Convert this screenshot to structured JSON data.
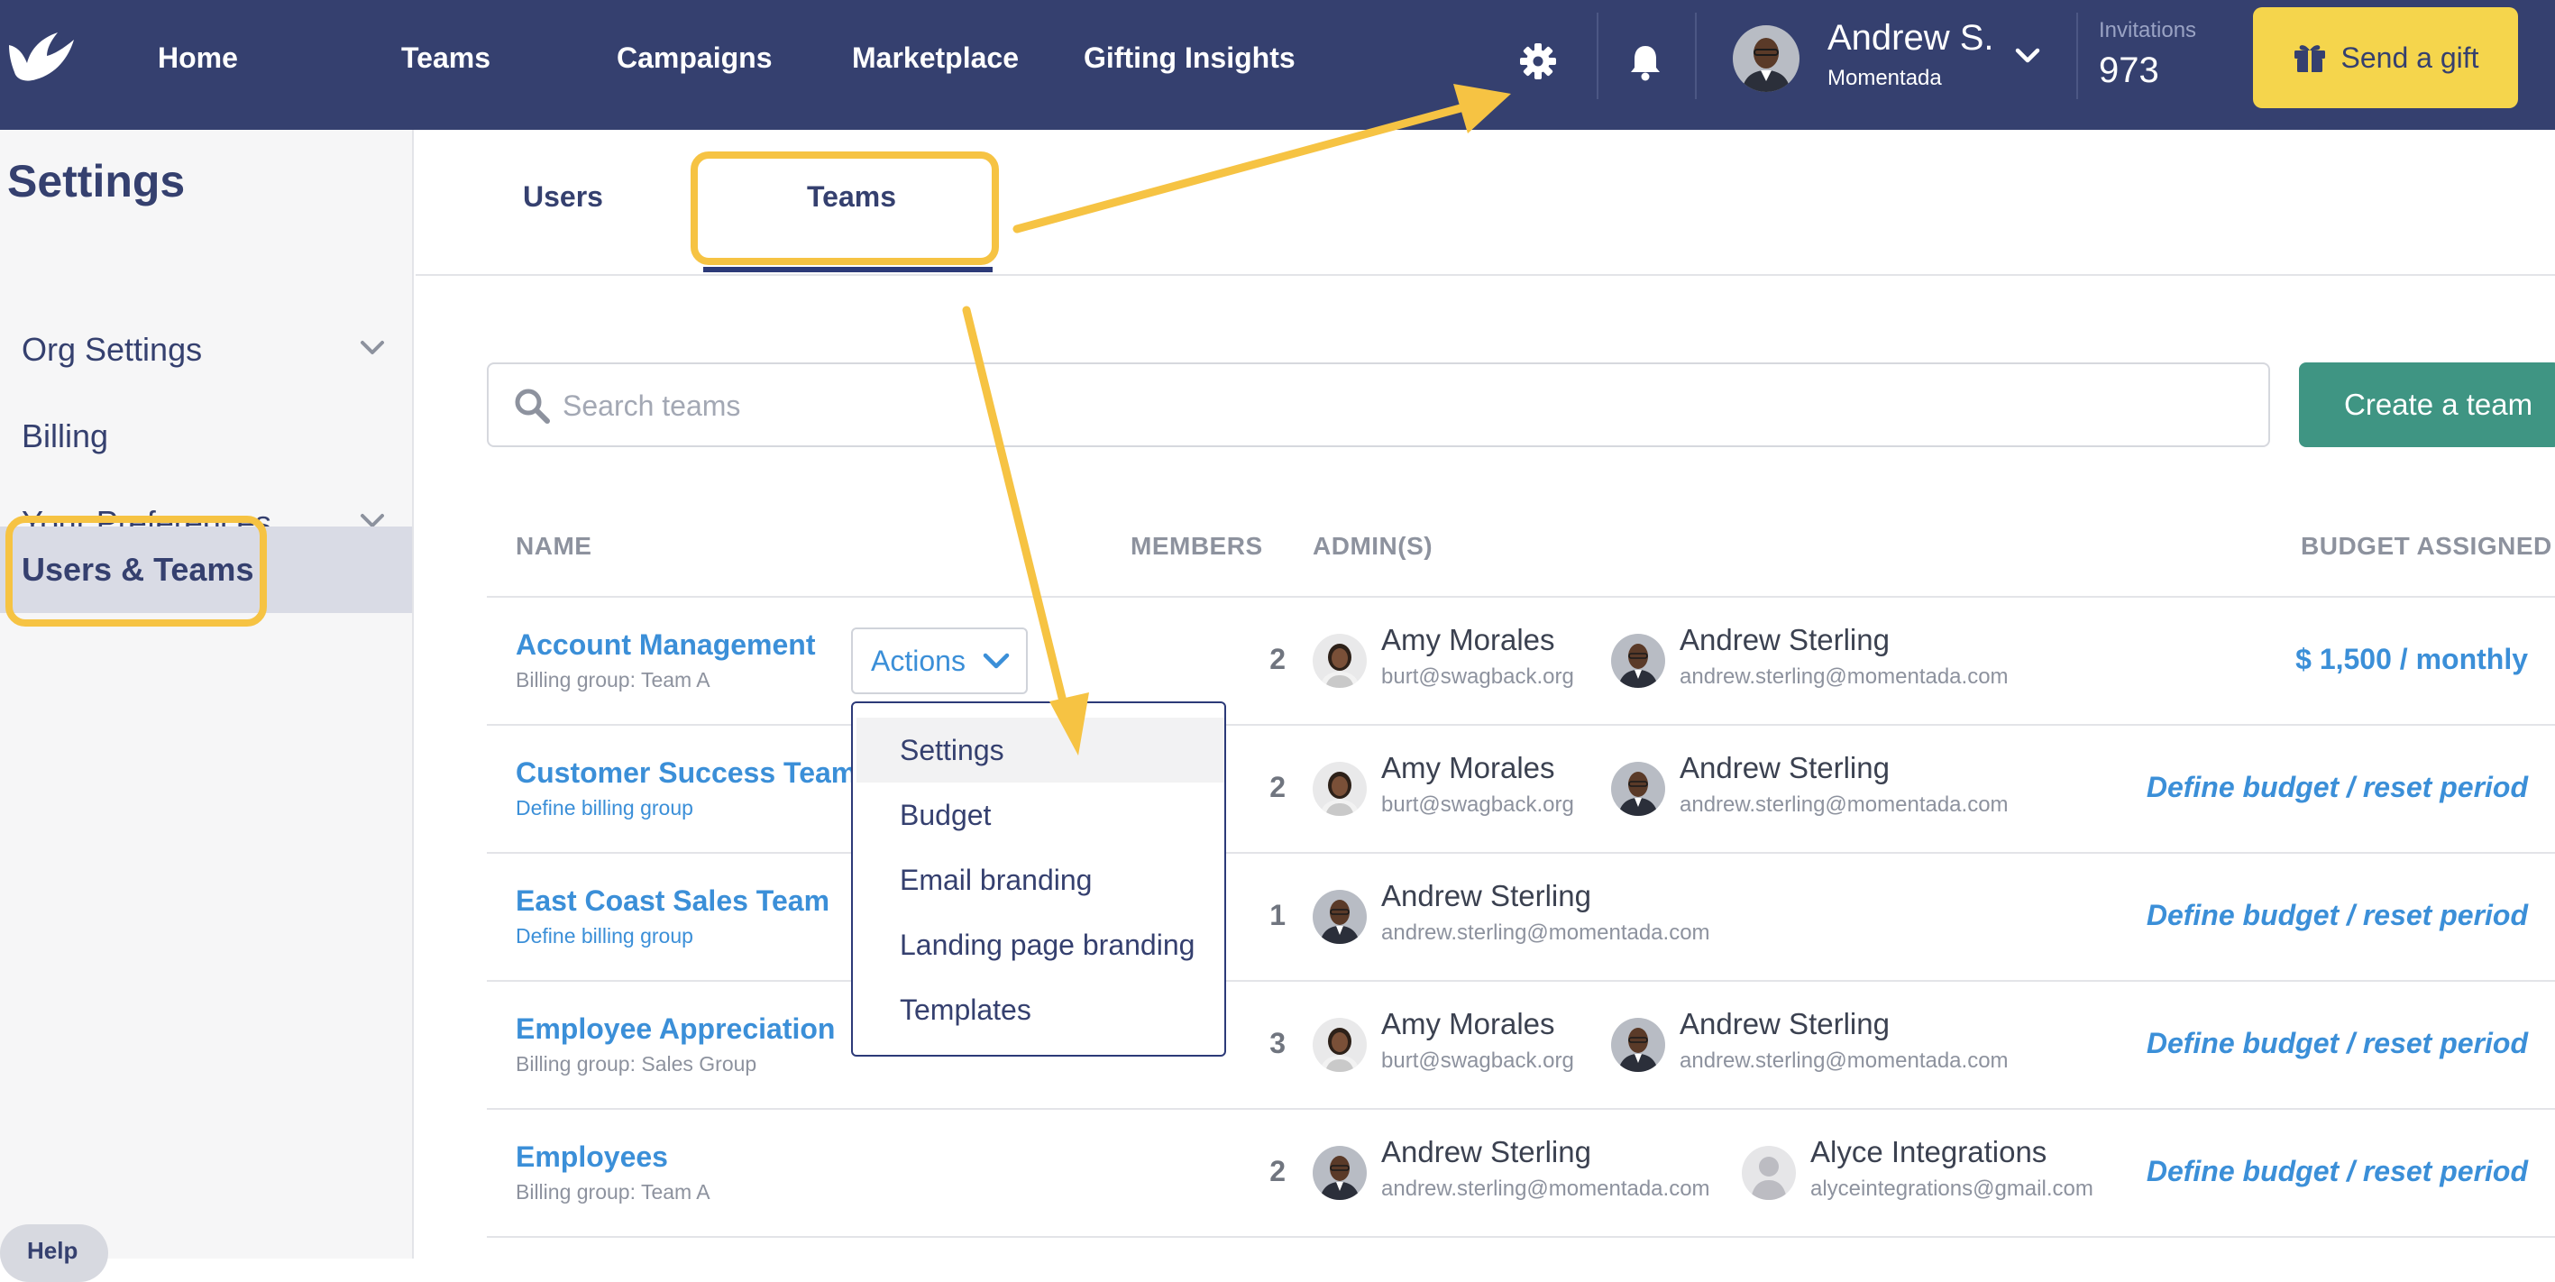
{
  "nav": {
    "links": [
      "Home",
      "Teams",
      "Campaigns",
      "Marketplace",
      "Gifting Insights"
    ],
    "user_name": "Andrew S.",
    "user_org": "Momentada",
    "invitations_label": "Invitations",
    "invitations_count": "973",
    "send_gift_label": "Send a gift"
  },
  "sidebar": {
    "title": "Settings",
    "items": [
      {
        "label": "Org Settings",
        "expandable": true
      },
      {
        "label": "Billing",
        "expandable": false
      },
      {
        "label": "Your Preferences",
        "expandable": true
      },
      {
        "label": "Users & Teams",
        "expandable": false,
        "active": true
      }
    ],
    "help_label": "Help"
  },
  "tabs": {
    "users": "Users",
    "teams": "Teams",
    "active": "Teams"
  },
  "search": {
    "placeholder": "Search teams",
    "value": ""
  },
  "create_team_label": "Create a team",
  "table": {
    "headers": {
      "name": "NAME",
      "members": "MEMBERS",
      "admins": "ADMIN(S)",
      "budget": "BUDGET ASSIGNED"
    },
    "rows": [
      {
        "name": "Account Management",
        "billing": "Billing group: Team A",
        "members": "2",
        "admins": [
          {
            "name": "Amy Morales",
            "email": "burt@swagback.org"
          },
          {
            "name": "Andrew Sterling",
            "email": "andrew.sterling@momentada.com"
          }
        ],
        "budget": "$ 1,500 / monthly"
      },
      {
        "name": "Customer Success Team - E",
        "billing": "Define billing group",
        "members": "2",
        "admins": [
          {
            "name": "Amy Morales",
            "email": "burt@swagback.org"
          },
          {
            "name": "Andrew Sterling",
            "email": "andrew.sterling@momentada.com"
          }
        ],
        "budget": "Define budget / reset period"
      },
      {
        "name": "East Coast Sales Team",
        "billing": "Define billing group",
        "members": "1",
        "admins": [
          {
            "name": "Andrew Sterling",
            "email": "andrew.sterling@momentada.com"
          }
        ],
        "budget": "Define budget / reset period"
      },
      {
        "name": "Employee Appreciation",
        "billing": "Billing group: Sales Group",
        "members": "3",
        "admins": [
          {
            "name": "Amy Morales",
            "email": "burt@swagback.org"
          },
          {
            "name": "Andrew Sterling",
            "email": "andrew.sterling@momentada.com"
          }
        ],
        "budget": "Define budget / reset period"
      },
      {
        "name": "Employees",
        "billing": "Billing group: Team A",
        "members": "2",
        "admins": [
          {
            "name": "Andrew Sterling",
            "email": "andrew.sterling@momentada.com"
          },
          {
            "name": "Alyce Integrations",
            "email": "alyceintegrations@gmail.com"
          }
        ],
        "budget": "Define budget / reset period"
      }
    ]
  },
  "actions_menu": {
    "button_label": "Actions",
    "items": [
      "Settings",
      "Budget",
      "Email branding",
      "Landing page branding",
      "Templates"
    ]
  },
  "colors": {
    "nav_bg": "#35406f",
    "accent_yellow": "#f5d54c",
    "highlight_yellow": "#f6c343",
    "link_blue": "#3b8fd8",
    "create_green": "#3f9583"
  }
}
